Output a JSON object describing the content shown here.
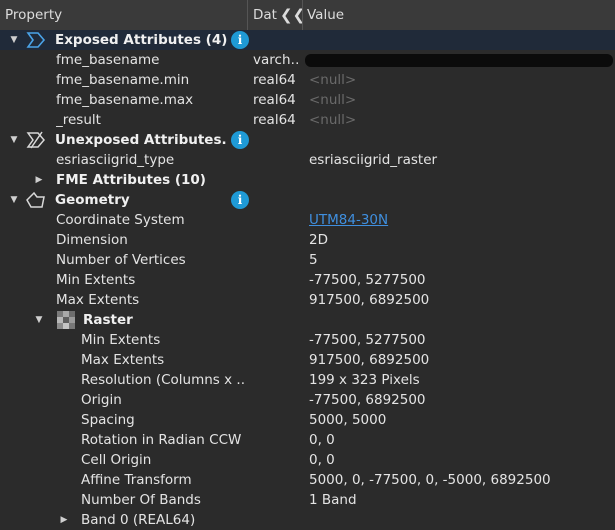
{
  "header": {
    "property": "Property",
    "data_type": "Dat",
    "collapse_glyph": "❮❮",
    "value": "Value"
  },
  "rows": [
    {
      "type": "group",
      "label": "Exposed Attributes (4)",
      "expanded": true,
      "icon": "exposed-attributes-icon",
      "info": true
    },
    {
      "label": "fme_basename",
      "dtype": "varch…",
      "value": "",
      "redacted": true
    },
    {
      "label": "fme_basename.min",
      "dtype": "real64",
      "value": "<null>",
      "null": true
    },
    {
      "label": "fme_basename.max",
      "dtype": "real64",
      "value": "<null>",
      "null": true
    },
    {
      "label": "_result",
      "dtype": "real64",
      "value": "<null>",
      "null": true
    },
    {
      "type": "group",
      "label": "Unexposed Attributes...",
      "expanded": true,
      "icon": "unexposed-attributes-icon",
      "info": true
    },
    {
      "label": "esriasciigrid_type",
      "dtype": "",
      "value": "esriasciigrid_raster"
    },
    {
      "type": "subgroup",
      "label": "FME Attributes (10)",
      "expanded": false
    },
    {
      "type": "group",
      "label": "Geometry",
      "expanded": true,
      "icon": "geometry-icon",
      "info": true
    },
    {
      "label": "Coordinate System",
      "value": "UTM84-30N",
      "link": true
    },
    {
      "label": "Dimension",
      "value": "2D"
    },
    {
      "label": "Number of Vertices",
      "value": "5"
    },
    {
      "label": "Min Extents",
      "value": "-77500, 5277500"
    },
    {
      "label": "Max Extents",
      "value": "917500, 6892500"
    },
    {
      "type": "raster",
      "label": "Raster",
      "expanded": true,
      "icon": "raster-icon"
    },
    {
      "label": "Min Extents",
      "value": "-77500, 5277500",
      "indent": true
    },
    {
      "label": "Max Extents",
      "value": "917500, 6892500",
      "indent": true
    },
    {
      "label": "Resolution (Columns x ...",
      "value": "199 x 323 Pixels",
      "indent": true
    },
    {
      "label": "Origin",
      "value": "-77500, 6892500",
      "indent": true
    },
    {
      "label": "Spacing",
      "value": "5000, 5000",
      "indent": true
    },
    {
      "label": "Rotation in Radian CCW",
      "value": "0, 0",
      "indent": true
    },
    {
      "label": "Cell Origin",
      "value": "0, 0",
      "indent": true
    },
    {
      "label": "Affine Transform",
      "value": "5000, 0, -77500, 0, -5000, 6892500",
      "indent": true
    },
    {
      "label": "Number Of Bands",
      "value": "1 Band",
      "indent": true
    },
    {
      "type": "band",
      "label": "Band 0 (REAL64)",
      "expanded": false
    }
  ]
}
